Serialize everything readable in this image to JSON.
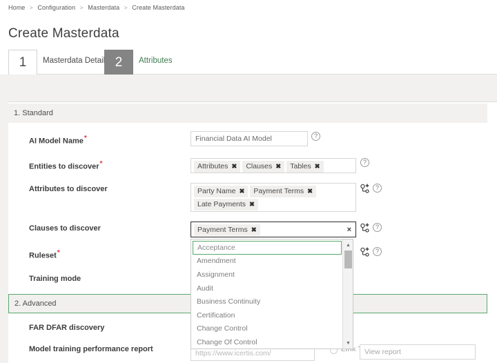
{
  "breadcrumb": {
    "items": [
      "Home",
      "Configuration",
      "Masterdata",
      "Create Masterdata"
    ],
    "separator": ">"
  },
  "page": {
    "title": "Create Masterdata"
  },
  "wizard": {
    "steps": [
      {
        "number": "1",
        "label": "Masterdata Details",
        "active": false
      },
      {
        "number": "2",
        "label": "Attributes",
        "active": true
      }
    ]
  },
  "sections": {
    "standard": {
      "title": "1. Standard"
    },
    "advanced": {
      "title": "2. Advanced"
    }
  },
  "fields": {
    "ai_model_name": {
      "label": "AI Model Name",
      "required": true,
      "value": "Financial Data AI Model",
      "help": "?"
    },
    "entities_to_discover": {
      "label": "Entities to discover",
      "required": true,
      "tags": [
        "Attributes",
        "Clauses",
        "Tables"
      ],
      "help": "?"
    },
    "attributes_to_discover": {
      "label": "Attributes to discover",
      "required": false,
      "tags": [
        "Party Name",
        "Payment Terms",
        "Late Payments"
      ],
      "help": "?"
    },
    "clauses_to_discover": {
      "label": "Clauses to discover",
      "required": false,
      "tags": [
        "Payment Terms"
      ],
      "clear_all": "×",
      "focused": true,
      "help": "?"
    },
    "ruleset": {
      "label": "Ruleset",
      "required": true,
      "help": "?"
    },
    "training_mode": {
      "label": "Training mode",
      "required": false
    },
    "far_dfar_discovery": {
      "label": "FAR DFAR discovery",
      "required": false
    },
    "model_training_performance_report": {
      "label": "Model training performance report",
      "required": false,
      "url_value": "https://www.icertis.com/",
      "link_text_label": "Link Text",
      "view_report_placeholder": "View report"
    }
  },
  "dropdown": {
    "open": true,
    "options": [
      "Acceptance",
      "Amendment",
      "Assignment",
      "Audit",
      "Business Continuity",
      "Certification",
      "Change Control",
      "Change Of Control"
    ],
    "highlighted_index": 0,
    "scroll_up": "▲",
    "scroll_down": "▼"
  },
  "tag_remove_glyph": "✖",
  "colors": {
    "accent_green": "#3f7a4f",
    "section_border_green": "#5aa76c",
    "required_red": "#e0333a",
    "step_active_bg": "#848484",
    "band_grey": "#f2f1f0",
    "tag_bg": "#f0efee"
  }
}
